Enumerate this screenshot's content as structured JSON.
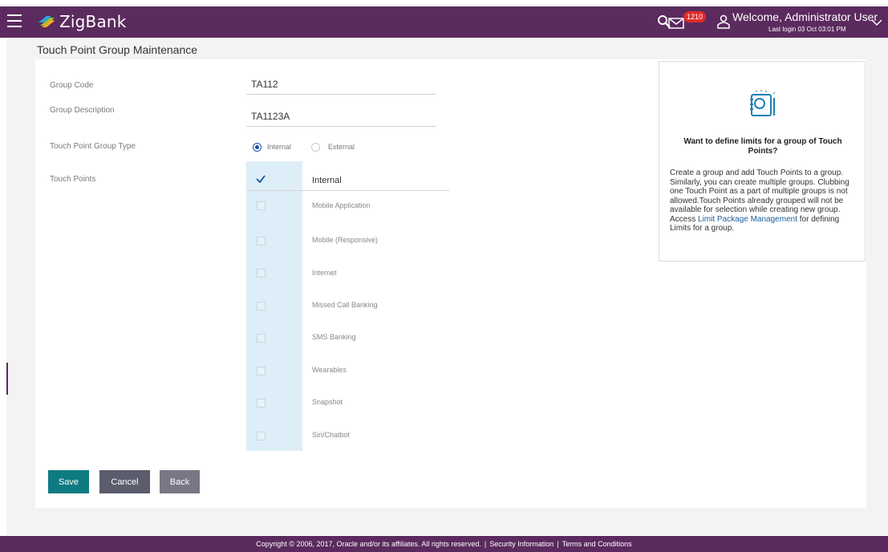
{
  "header": {
    "brand": "ZigBank",
    "mail_count": "1210",
    "welcome": "Welcome, Administrator User",
    "last_login": "Last login 03 Oct 03:01 PM",
    "colors": {
      "header_bg": "#5b2a5e",
      "badge": "#e02b2b"
    },
    "icons": [
      "menu-icon",
      "zigbank-logo-icon",
      "search-icon",
      "mail-icon",
      "user-icon",
      "chevron-down-icon"
    ]
  },
  "page": {
    "title": "Touch Point Group Maintenance"
  },
  "form": {
    "group_code_label": "Group Code",
    "group_code_value": "TA112",
    "group_description_label": "Group Description",
    "group_description_value": "TA1123A",
    "group_type_label": "Touch Point Group Type",
    "group_type_options": [
      "Internal",
      "External"
    ],
    "group_type_selected": "Internal",
    "touch_points_label": "Touch Points",
    "touch_points_header": "Internal",
    "touch_points": [
      "Mobile Application",
      "Mobile (Responsive)",
      "Internet",
      "Missed Call Banking",
      "SMS Banking",
      "Wearables",
      "Snapshot",
      "Siri/Chatbot"
    ]
  },
  "buttons": {
    "save": "Save",
    "cancel": "Cancel",
    "back": "Back",
    "colors": {
      "save": "#0e7b82",
      "cancel": "#5b5c6c",
      "back": "#777785"
    }
  },
  "help": {
    "title": "Want to define limits for a group of Touch Points?",
    "text_before_link": "Create a group and add Touch Points to a group. Similarly, you can create multiple groups. Clubbing one Touch Point as a part of multiple groups is not allowed.Touch Points already grouped will not be available for selection while creating new group. Access",
    "link": "Limit Package Management",
    "text_after_link": "for defining Limits for a group."
  },
  "footer": {
    "copyright": "Copyright © 2006, 2017, Oracle and/or its affiliates. All rights reserved.",
    "separator": "|",
    "security": "Security Information",
    "terms": "Terms and Conditions"
  }
}
